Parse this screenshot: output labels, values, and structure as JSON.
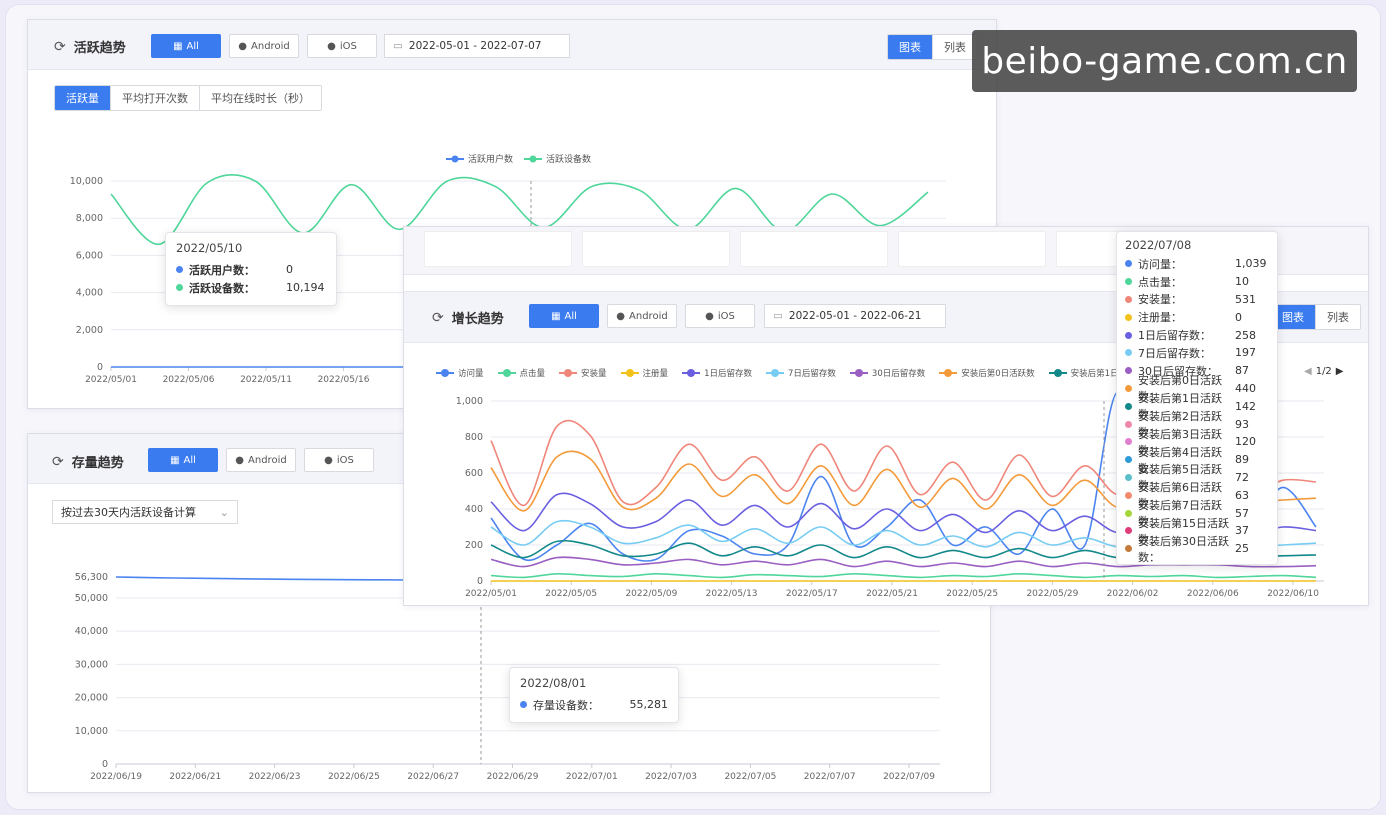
{
  "watermark": "beibo-game.com.cn",
  "active": {
    "title": "活跃趋势",
    "platforms": [
      "All",
      "Android",
      "iOS"
    ],
    "date_range": "2022-05-01 - 2022-07-07",
    "view_toggle": [
      "图表",
      "列表"
    ],
    "metric_tabs": [
      "活跃量",
      "平均打开次数",
      "平均在线时长（秒）"
    ],
    "tooltip": {
      "date": "2022/05/10",
      "rows": [
        {
          "label": "活跃用户数：",
          "value": "0",
          "color": "#4b84f0"
        },
        {
          "label": "活跃设备数：",
          "value": "10,194",
          "color": "#4fd69a"
        }
      ]
    }
  },
  "retention": {
    "title": "存量趋势",
    "platforms": [
      "All",
      "Android",
      "iOS"
    ],
    "select": "按过去30天内活跃设备计算",
    "tooltip": {
      "date": "2022/08/01",
      "rows": [
        {
          "label": "存量设备数：",
          "value": "55,281",
          "color": "#4b84f0"
        }
      ]
    }
  },
  "growth": {
    "title": "增长趋势",
    "platforms": [
      "All",
      "Android",
      "iOS"
    ],
    "date_range": "2022-05-01 - 2022-06-21",
    "view_toggle": [
      "图表",
      "列表"
    ],
    "legend_page": "1/2",
    "tooltip": {
      "date": "2022/07/08",
      "rows": [
        {
          "label": "访问量：",
          "value": "1,039",
          "color": "#4b84f0"
        },
        {
          "label": "点击量：",
          "value": "10",
          "color": "#4fd69a"
        },
        {
          "label": "安装量：",
          "value": "531",
          "color": "#f0867a"
        },
        {
          "label": "注册量：",
          "value": "0",
          "color": "#f2c21a"
        },
        {
          "label": "1日后留存数：",
          "value": "258",
          "color": "#6a5fe0"
        },
        {
          "label": "7日后留存数：",
          "value": "197",
          "color": "#78ccf3"
        },
        {
          "label": "30日后留存数：",
          "value": "87",
          "color": "#9a5fc2"
        },
        {
          "label": "安装后第0日活跃数：",
          "value": "440",
          "color": "#f39a3a"
        },
        {
          "label": "安装后第1日活跃数：",
          "value": "142",
          "color": "#13888a"
        },
        {
          "label": "安装后第2日活跃数：",
          "value": "93",
          "color": "#ee86ae"
        },
        {
          "label": "安装后第3日活跃数：",
          "value": "120",
          "color": "#e07fd0"
        },
        {
          "label": "安装后第4日活跃数：",
          "value": "89",
          "color": "#2f9ad8"
        },
        {
          "label": "安装后第5日活跃数：",
          "value": "72",
          "color": "#5bc0c8"
        },
        {
          "label": "安装后第6日活跃数：",
          "value": "63",
          "color": "#f38a6e"
        },
        {
          "label": "安装后第7日活跃数：",
          "value": "57",
          "color": "#a5d63a"
        },
        {
          "label": "安装后第15日活跃数：",
          "value": "37",
          "color": "#e03c7a"
        },
        {
          "label": "安装后第30日活跃数：",
          "value": "25",
          "color": "#c47a3a"
        }
      ]
    }
  },
  "chart_data": [
    {
      "type": "line",
      "title": "活跃趋势",
      "series": [
        {
          "name": "活跃用户数",
          "color": "#4b84f0",
          "values": [
            0,
            0,
            0,
            0,
            0,
            0,
            0,
            0,
            0,
            0,
            0,
            0,
            0,
            0,
            0,
            0,
            0,
            0
          ]
        },
        {
          "name": "活跃设备数",
          "color": "#4fd69a",
          "values": [
            9300,
            6600,
            9900,
            10000,
            7200,
            9800,
            7400,
            10000,
            9700,
            7500,
            9700,
            9500,
            7400,
            9600,
            7300,
            9300,
            7600,
            9400
          ]
        }
      ],
      "x_ticks": [
        "2022/05/01",
        "2022/05/06",
        "2022/05/11",
        "2022/05/16"
      ],
      "y_ticks": [
        0,
        2000,
        4000,
        6000,
        8000,
        10000
      ],
      "y_tick_labels": [
        "0",
        "2,000",
        "4,000",
        "6,000",
        "8,000",
        "10,000"
      ],
      "ylim": [
        0,
        10000
      ],
      "legend": "top-center"
    },
    {
      "type": "line",
      "title": "存量趋势",
      "series": [
        {
          "name": "存量设备数",
          "color": "#4b84f0",
          "values": [
            56300,
            56000,
            55800,
            55600,
            55500,
            55400
          ]
        }
      ],
      "x_ticks": [
        "2022/06/19",
        "2022/06/21",
        "2022/06/23",
        "2022/06/25",
        "2022/06/27",
        "2022/06/29",
        "2022/07/01",
        "2022/07/03",
        "2022/07/05",
        "2022/07/07",
        "2022/07/09"
      ],
      "y_ticks": [
        0,
        10000,
        20000,
        30000,
        40000,
        50000
      ],
      "y_tick_labels": [
        "0",
        "10,000",
        "20,000",
        "30,000",
        "40,000",
        "50,000"
      ],
      "extra_y_label": "56,300",
      "ylim": [
        0,
        56300
      ]
    },
    {
      "type": "line",
      "title": "增长趋势",
      "x_ticks": [
        "2022/05/01",
        "2022/05/05",
        "2022/05/09",
        "2022/05/13",
        "2022/05/17",
        "2022/05/21",
        "2022/05/25",
        "2022/05/29",
        "2022/06/02",
        "2022/06/06",
        "2022/06/10"
      ],
      "y_ticks": [
        0,
        200,
        400,
        600,
        800,
        1000
      ],
      "y_tick_labels": [
        "0",
        "200",
        "400",
        "600",
        "800",
        "1,000"
      ],
      "ylim": [
        0,
        1000
      ],
      "series": [
        {
          "name": "访问量",
          "color": "#4b84f0",
          "values": [
            350,
            120,
            200,
            320,
            150,
            120,
            280,
            250,
            150,
            200,
            580,
            200,
            300,
            450,
            200,
            300,
            150,
            400,
            200,
            1050,
            200,
            400,
            350,
            300,
            520,
            300
          ]
        },
        {
          "name": "点击量",
          "color": "#4fd69a",
          "values": [
            30,
            20,
            40,
            30,
            25,
            40,
            30,
            20,
            35,
            30,
            25,
            40,
            30,
            20,
            30,
            25,
            40,
            30,
            20,
            30,
            25,
            30,
            20,
            25,
            30,
            20
          ]
        },
        {
          "name": "安装量",
          "color": "#f0867a",
          "values": [
            780,
            420,
            860,
            810,
            440,
            520,
            760,
            560,
            690,
            500,
            760,
            500,
            750,
            480,
            660,
            450,
            700,
            470,
            640,
            480,
            620,
            510,
            570,
            480,
            560,
            550
          ]
        },
        {
          "name": "注册量",
          "color": "#f2c21a",
          "values": [
            0,
            0,
            0,
            0,
            0,
            0,
            0,
            0,
            0,
            0,
            0,
            0,
            0,
            0,
            0,
            0,
            0,
            0,
            0,
            0,
            0,
            0,
            0,
            0,
            0,
            0
          ]
        },
        {
          "name": "1日后留存数",
          "color": "#6a5fe0",
          "values": [
            440,
            280,
            480,
            430,
            300,
            330,
            450,
            310,
            420,
            300,
            430,
            290,
            400,
            280,
            370,
            270,
            390,
            280,
            360,
            270,
            350,
            290,
            310,
            260,
            300,
            280
          ]
        },
        {
          "name": "7日后留存数",
          "color": "#78ccf3",
          "values": [
            300,
            200,
            330,
            300,
            210,
            240,
            310,
            220,
            290,
            210,
            300,
            200,
            280,
            200,
            250,
            190,
            270,
            200,
            240,
            190,
            230,
            200,
            210,
            190,
            200,
            210
          ]
        },
        {
          "name": "30日后留存数",
          "color": "#9a5fc2",
          "values": [
            120,
            80,
            130,
            120,
            90,
            100,
            120,
            90,
            110,
            90,
            120,
            80,
            110,
            80,
            100,
            80,
            110,
            80,
            100,
            80,
            90,
            90,
            90,
            80,
            80,
            85
          ]
        },
        {
          "name": "安装后第0日活跃数",
          "color": "#f39a3a",
          "values": [
            630,
            390,
            690,
            680,
            410,
            460,
            650,
            470,
            590,
            430,
            640,
            420,
            620,
            410,
            570,
            400,
            590,
            420,
            560,
            410,
            540,
            450,
            480,
            440,
            450,
            460
          ]
        },
        {
          "name": "安装后第1日活跃数",
          "color": "#13888a",
          "values": [
            200,
            130,
            220,
            200,
            140,
            150,
            210,
            140,
            190,
            140,
            200,
            130,
            190,
            130,
            170,
            130,
            180,
            130,
            170,
            130,
            160,
            140,
            150,
            140,
            140,
            145
          ]
        }
      ],
      "legend": "top",
      "legend_entries": [
        "访问量",
        "点击量",
        "安装量",
        "注册量",
        "1日后留存数",
        "7日后留存数",
        "30日后留存数",
        "安装后第0日活跃数",
        "安装后第1日活跃数"
      ]
    }
  ]
}
